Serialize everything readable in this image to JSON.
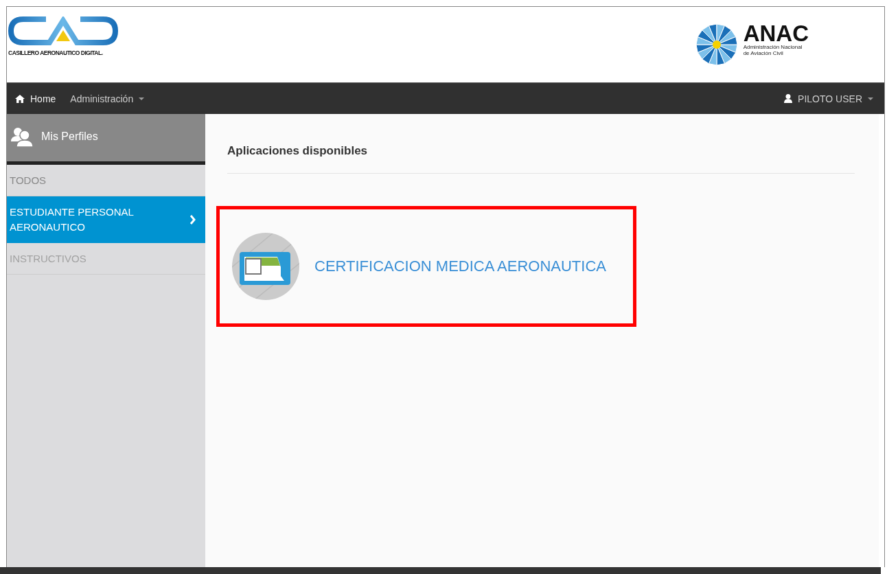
{
  "header": {
    "cad_logo": {
      "caption": "CASILLERO AERONAUTICO DIGITAL."
    },
    "anac_logo": {
      "name": "ANAC",
      "subtitle_1": "Administración Nacional",
      "subtitle_2": "de Aviación Civil"
    }
  },
  "navbar": {
    "items": [
      {
        "label": "Home",
        "kind": "home"
      },
      {
        "label": "Administración",
        "kind": "dropdown"
      }
    ],
    "user": {
      "label": "PILOTO USER"
    }
  },
  "sidebar": {
    "title": "Mis Perfiles",
    "items": [
      {
        "label": "TODOS",
        "selected": false,
        "disabled": false
      },
      {
        "label": "ESTUDIANTE PERSONAL AERONAUTICO",
        "selected": true,
        "disabled": false
      },
      {
        "label": "INSTRUCTIVOS",
        "selected": false,
        "disabled": true
      }
    ]
  },
  "main": {
    "title": "Aplicaciones disponibles",
    "apps": [
      {
        "label": "CERTIFICACION MEDICA AERONAUTICA",
        "highlighted": true
      }
    ]
  }
}
